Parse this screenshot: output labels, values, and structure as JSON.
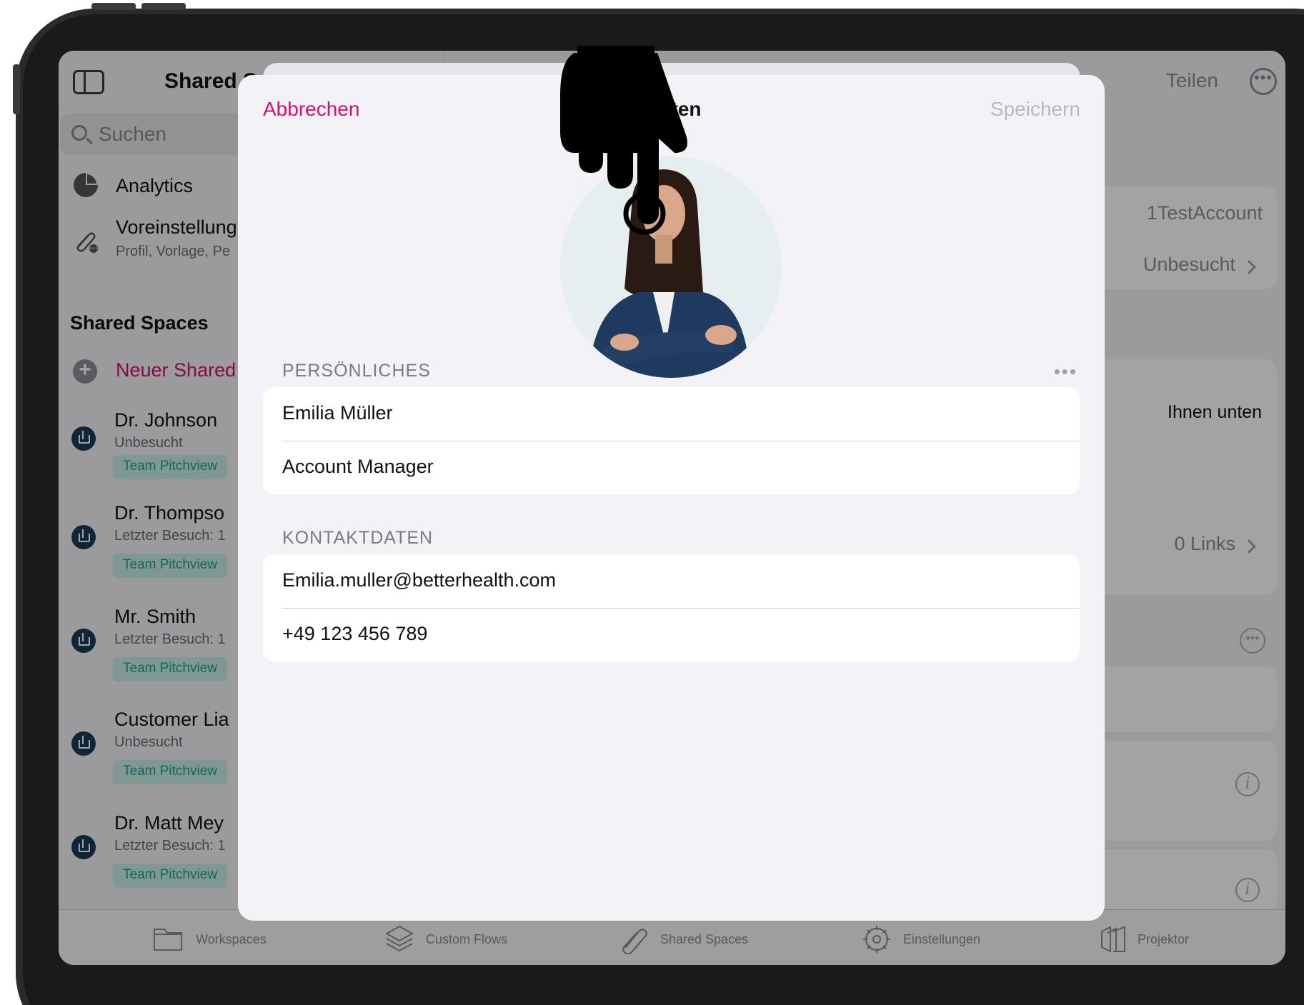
{
  "sidebar": {
    "title": "Shared S",
    "search_placeholder": "Suchen",
    "nav": [
      {
        "label": "Analytics",
        "icon": "pie-chart-icon"
      },
      {
        "label": "Voreinstellung",
        "sub": "Profil, Vorlage, Pe",
        "icon": "paperclip-settings-icon"
      }
    ],
    "section_title": "Shared Spaces",
    "new_label": "Neuer Shared",
    "spaces": [
      {
        "name": "Dr. Johnson",
        "status": "Unbesucht",
        "tag": "Team Pitchview"
      },
      {
        "name": "Dr. Thompso",
        "status": "Letzter Besuch: 1",
        "tag": "Team Pitchview"
      },
      {
        "name": "Mr. Smith",
        "status": "Letzter Besuch: 1",
        "tag": "Team Pitchview"
      },
      {
        "name": "Customer Lia",
        "status": "Unbesucht",
        "tag": "Team Pitchview"
      },
      {
        "name": "Dr. Matt Mey",
        "status": "Letzter Besuch: 1",
        "tag": "Team Pitchview"
      }
    ]
  },
  "detail": {
    "share_label": "Teilen",
    "account": "1TestAccount",
    "visit_status": "Unbesucht",
    "info_text": "Ihnen unten",
    "links": "0 Links"
  },
  "tabbar": [
    {
      "label": "Workspaces",
      "icon": "folder-icon"
    },
    {
      "label": "Custom Flows",
      "icon": "layers-icon"
    },
    {
      "label": "Shared Spaces",
      "icon": "paperclip-icon"
    },
    {
      "label": "Einstellungen",
      "icon": "gear-icon"
    },
    {
      "label": "Projektor",
      "icon": "projector-icon"
    }
  ],
  "sheet": {
    "cancel_label": "Abbrechen",
    "title": "tdaten",
    "save_label": "Speichern",
    "more_label": "•••",
    "personal_header": "PERSÖNLICHES",
    "personal": [
      "Emilia Müller",
      "Account Manager"
    ],
    "contact_header": "KONTAKTDATEN",
    "contact": [
      "Emilia.muller@betterhealth.com",
      "+49 123 456 789"
    ]
  },
  "colors": {
    "accent": "#d1126b",
    "tag_bg": "#c7eee8",
    "tag_text": "#1e9e8f",
    "badge": "#1c3b5a"
  }
}
